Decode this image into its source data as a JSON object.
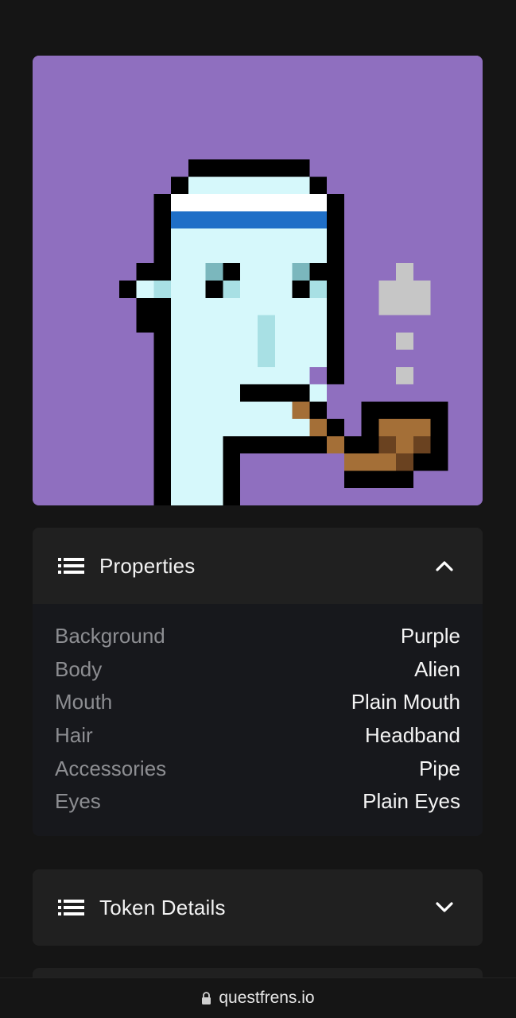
{
  "nft": {
    "image_name": "alien-headband-pipe-punk",
    "colors": {
      "background": "#8f6fbf",
      "skin": "#d6f8fb",
      "headband_white": "#ffffff",
      "headband_blue": "#1f6fc7",
      "eye": "#7bb7bd",
      "pipe": "#a46f37",
      "pipe_dark": "#6a4220",
      "smoke": "#c6c6c6"
    }
  },
  "properties_panel": {
    "icon": "list-icon",
    "title": "Properties",
    "toggle_icon": "chevron-up-icon",
    "rows": [
      {
        "key": "Background",
        "value": "Purple"
      },
      {
        "key": "Body",
        "value": "Alien"
      },
      {
        "key": "Mouth",
        "value": "Plain Mouth"
      },
      {
        "key": "Hair",
        "value": "Headband"
      },
      {
        "key": "Accessories",
        "value": "Pipe"
      },
      {
        "key": "Eyes",
        "value": "Plain Eyes"
      }
    ]
  },
  "token_details_panel": {
    "icon": "list-icon",
    "title": "Token Details",
    "toggle_icon": "chevron-down-icon"
  },
  "browser_bar": {
    "icon": "lock-icon",
    "url": "questfrens.io"
  }
}
